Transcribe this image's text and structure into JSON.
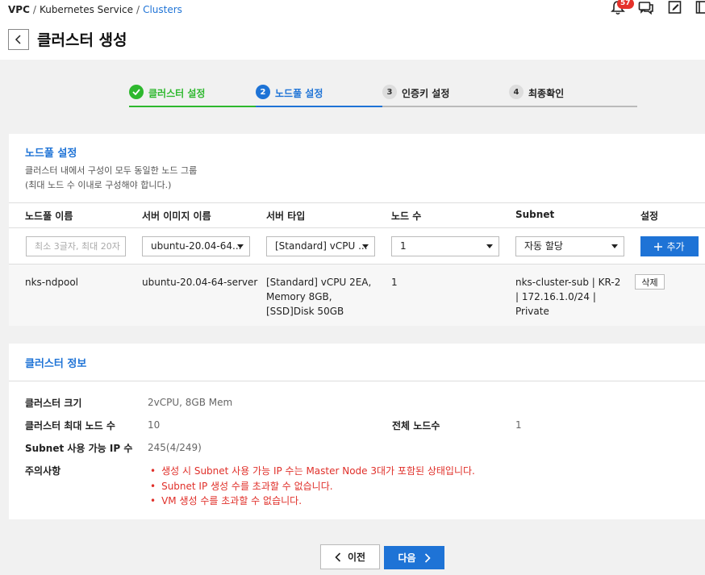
{
  "breadcrumb": {
    "root": "VPC",
    "service": "Kubernetes Service",
    "current": "Clusters"
  },
  "topbar": {
    "notification_count": "57",
    "icons": [
      "bell-icon",
      "chat-icon",
      "edit-icon",
      "book-icon"
    ]
  },
  "page": {
    "title": "클러스터 생성"
  },
  "steps": [
    {
      "num": "",
      "label": "클러스터 설정",
      "state": "done"
    },
    {
      "num": "2",
      "label": "노드풀 설정",
      "state": "active"
    },
    {
      "num": "3",
      "label": "인증키 설정",
      "state": "pending"
    },
    {
      "num": "4",
      "label": "최종확인",
      "state": "pending"
    }
  ],
  "nodepool": {
    "title": "노드풀 설정",
    "desc1": "클러스터 내에서 구성이 모두 동일한 노드 그룹",
    "desc2": "(최대 노드 수 이내로 구성해야 합니다.)",
    "headers": {
      "name": "노드풀 이름",
      "image": "서버 이미지 이름",
      "type": "서버 타입",
      "count": "노드 수",
      "subnet": "Subnet",
      "setting": "설정"
    },
    "input": {
      "name_placeholder": "최소 3글자, 최대 20자",
      "image": "ubuntu-20.04-64...",
      "type": "[Standard] vCPU ...",
      "count": "1",
      "subnet": "자동 할당",
      "add_label": "추가"
    },
    "row": {
      "name": "nks-ndpool",
      "image": "ubuntu-20.04-64-server",
      "type": "[Standard] vCPU 2EA, Memory 8GB, [SSD]Disk 50GB",
      "count": "1",
      "subnet": "nks-cluster-sub | KR-2 | 172.16.1.0/24 | Private",
      "delete_label": "삭제"
    }
  },
  "cluster_info": {
    "title": "클러스터 정보",
    "size_label": "클러스터 크기",
    "size_value": "2vCPU, 8GB Mem",
    "max_nodes_label": "클러스터 최대 노드 수",
    "max_nodes_value": "10",
    "total_nodes_label": "전체 노드수",
    "total_nodes_value": "1",
    "subnet_ip_label": "Subnet 사용 가능 IP 수",
    "subnet_ip_value": "245(4/249)",
    "notes_label": "주의사항",
    "notes": [
      "생성 시 Subnet 사용 가능 IP 수는 Master Node 3대가 포함된 상태입니다.",
      "Subnet IP 생성 수를 초과할 수 없습니다.",
      "VM 생성 수를 초과할 수 없습니다."
    ]
  },
  "footer": {
    "prev_label": "이전",
    "next_label": "다음"
  },
  "colors": {
    "accent": "#1e73d6",
    "done": "#2eb82e",
    "warning": "#e0302a",
    "background": "#f1f1f1"
  }
}
